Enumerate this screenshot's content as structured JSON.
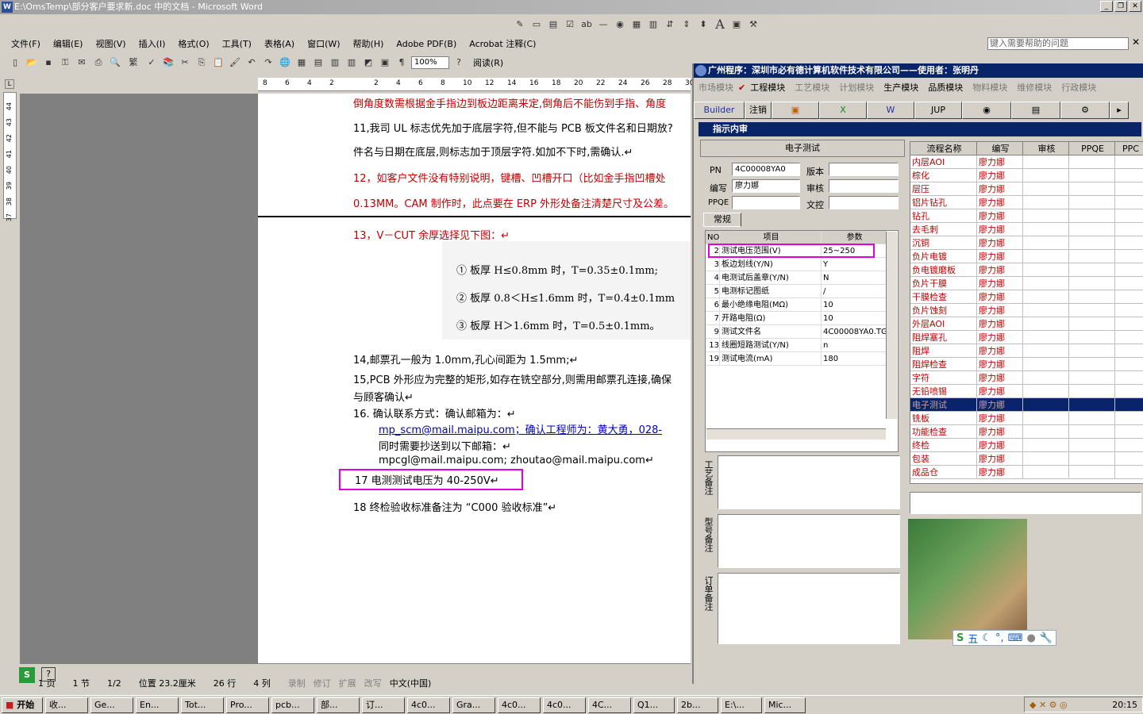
{
  "word": {
    "title": "E:\\OmsTemp\\部分客户要求新.doc 中的文档 - Microsoft Word",
    "help_placeholder": "键入需要帮助的问题",
    "menus": [
      "文件(F)",
      "编辑(E)",
      "视图(V)",
      "插入(I)",
      "格式(O)",
      "工具(T)",
      "表格(A)",
      "窗口(W)",
      "帮助(H)",
      "Adobe PDF(B)",
      "Acrobat 注释(C)"
    ],
    "zoom": "100%",
    "read_label": "阅读(R)",
    "ruler_ticks": [
      "8",
      "6",
      "4",
      "2",
      "",
      "2",
      "4",
      "6",
      "8",
      "10",
      "12",
      "14",
      "16",
      "18",
      "20",
      "22",
      "24",
      "26",
      "28",
      "30"
    ],
    "vruler_ticks": [
      "37",
      "38",
      "39",
      "40",
      "41",
      "42",
      "43",
      "44"
    ],
    "lines": [
      {
        "text": "倒角度数需根据金手指边到板边距离来定,倒角后不能伤到手指、角度",
        "cls": "red"
      },
      {
        "text": "11,我司 UL 标志优先加于底层字符,但不能与 PCB 板文件名和日期放?",
        "cls": ""
      },
      {
        "text": "件名与日期在底层,则标志加于顶层字符.如加不下时,需确认.↵",
        "cls": ""
      },
      {
        "text": "12，如客户文件没有特别说明，键槽、凹槽开口（比如金手指凹槽处",
        "cls": "red"
      },
      {
        "text": "0.13MM。CAM 制作时，此点要在 ERP 外形处备注清楚尺寸及公差。",
        "cls": "red"
      },
      {
        "text": "13，V－CUT 余厚选择见下图：↵",
        "cls": "red"
      },
      {
        "text": "①   板厚 H≤0.8mm 时，T=0.35±0.1mm;",
        "cls": ""
      },
      {
        "text": "②   板厚 0.8＜H≤1.6mm 时，T=0.4±0.1mm",
        "cls": ""
      },
      {
        "text": "③   板厚 H＞1.6mm 时，T=0.5±0.1mm。",
        "cls": ""
      },
      {
        "text": "14,邮票孔一般为 1.0mm,孔心间距为 1.5mm;↵",
        "cls": ""
      },
      {
        "text": "15,PCB 外形应为完整的矩形,如存在铣空部分,则需用邮票孔连接,确保",
        "cls": ""
      },
      {
        "text": "与顾客确认↵",
        "cls": ""
      },
      {
        "text": "16.  确认联系方式：确认邮箱为：↵",
        "cls": ""
      },
      {
        "text": "mp_scm@mail.maipu.com；确认工程师为：黄大勇，028-",
        "cls": "blue"
      },
      {
        "text": "同时需要抄送到以下邮箱：↵",
        "cls": ""
      },
      {
        "text": "mpcgl@mail.maipu.com; zhoutao@mail.maipu.com↵",
        "cls": ""
      },
      {
        "text": "17   电测测试电压为 40-250V↵",
        "cls": "hl"
      },
      {
        "text": "18   终检验收标准备注为 “C000 验收标准”↵",
        "cls": ""
      }
    ],
    "status": [
      "1 页",
      "1 节",
      "1/2",
      "位置 23.2厘米",
      "26 行",
      "4 列",
      "录制",
      "修订",
      "扩展",
      "改写",
      "中文(中国)"
    ]
  },
  "app": {
    "title": "广州程序：深圳市必有德计算机软件技术有限公司——使用者：张明丹",
    "modules": [
      "市场模块",
      "工程模块",
      "工艺模块",
      "计划模块",
      "生产模块",
      "品质模块",
      "物料模块",
      "维修模块",
      "行政模块"
    ],
    "buttons": [
      "Builder",
      "注销",
      "",
      "",
      "W",
      "JUP",
      "",
      "",
      "",
      ""
    ],
    "sub_title": "指示内审",
    "section": "电子测试",
    "fields": {
      "pn_label": "PN",
      "pn": "4C00008YA0",
      "version_label": "版本",
      "version": "",
      "author_label": "编写",
      "author": "廖力娜",
      "review_label": "审核",
      "review": "",
      "ppqe_label": "PPQE",
      "ppqe": "",
      "doc_label": "文控",
      "doc": ""
    },
    "tab": "常规",
    "grid_headers": [
      "NO",
      "项目",
      "参数"
    ],
    "grid_rows": [
      [
        "2",
        "测试电压范围(V)",
        "25~250"
      ],
      [
        "3",
        "板边划线(Y/N)",
        "Y"
      ],
      [
        "4",
        "电测试后盖章(Y/N)",
        "N"
      ],
      [
        "5",
        "电测标记图纸",
        "/"
      ],
      [
        "6",
        "最小绝缘电阻(MΩ)",
        "10"
      ],
      [
        "7",
        "开路电阻(Ω)",
        "10"
      ],
      [
        "9",
        "测试文件名",
        "4C00008YA0.TG"
      ],
      [
        "13",
        "线圈短路测试(Y/N)",
        "n"
      ],
      [
        "19",
        "测试电流(mA)",
        "180"
      ]
    ],
    "notes": [
      "工艺备注",
      "型号备注",
      "订单备注"
    ],
    "flow_headers": [
      "流程名称",
      "编写",
      "审核",
      "PPQE",
      "PPC"
    ],
    "flow_rows": [
      [
        "内层AOI",
        "廖力娜"
      ],
      [
        "棕化",
        "廖力娜"
      ],
      [
        "层压",
        "廖力娜"
      ],
      [
        "铝片钻孔",
        "廖力娜"
      ],
      [
        "钻孔",
        "廖力娜"
      ],
      [
        "去毛刺",
        "廖力娜"
      ],
      [
        "沉铜",
        "廖力娜"
      ],
      [
        "负片电镀",
        "廖力娜"
      ],
      [
        "负电镀磨板",
        "廖力娜"
      ],
      [
        "负片干膜",
        "廖力娜"
      ],
      [
        "干膜检查",
        "廖力娜"
      ],
      [
        "负片蚀刻",
        "廖力娜"
      ],
      [
        "外层AOI",
        "廖力娜"
      ],
      [
        "阻焊塞孔",
        "廖力娜"
      ],
      [
        "阻焊",
        "廖力娜"
      ],
      [
        "阻焊检查",
        "廖力娜"
      ],
      [
        "字符",
        "廖力娜"
      ],
      [
        "无铅喷锡",
        "廖力娜"
      ],
      [
        "电子测试",
        "廖力娜"
      ],
      [
        "铣板",
        "廖力娜"
      ],
      [
        "功能检查",
        "廖力娜"
      ],
      [
        "终检",
        "廖力娜"
      ],
      [
        "包装",
        "廖力娜"
      ],
      [
        "成品仓",
        "廖力娜"
      ]
    ],
    "selected_flow": 18,
    "ime": "五"
  },
  "taskbar": {
    "start": "开始",
    "tasks": [
      "收...",
      "Ge...",
      "En...",
      "Tot...",
      "Pro...",
      "pcb...",
      "部...",
      "订...",
      "4c0...",
      "Gra...",
      "4c0...",
      "4c0...",
      "4C...",
      "Q1...",
      "2b...",
      "E:\\...",
      "Mic..."
    ],
    "clock": "20:15"
  },
  "colors": {
    "accent": "#0a246a",
    "red_text": "#c00000",
    "highlight": "#e000e0"
  }
}
